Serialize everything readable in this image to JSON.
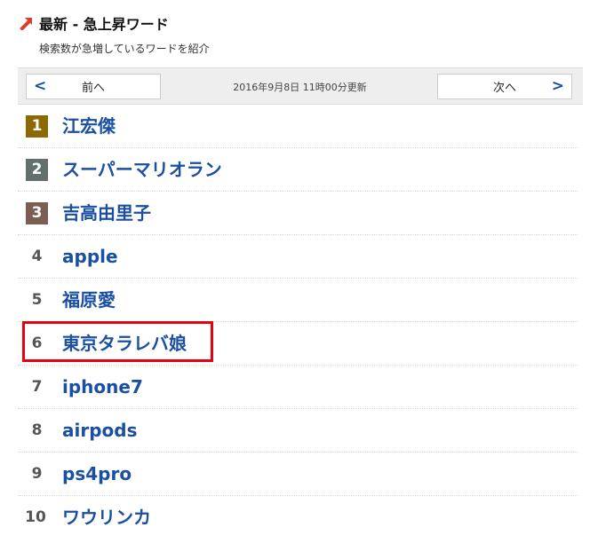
{
  "header": {
    "title": "最新 - 急上昇ワード",
    "subtitle": "検索数が急増しているワードを紹介",
    "icon": "trending-arrow-icon",
    "accent_color": "#e03a2b"
  },
  "nav": {
    "prev_label": "前へ",
    "next_label": "次へ",
    "prev_chevron": "<",
    "next_chevron": ">",
    "updated": "2016年9月8日 11時00分更新"
  },
  "ranking": [
    {
      "rank": "1",
      "word": "江宏傑"
    },
    {
      "rank": "2",
      "word": "スーパーマリオラン"
    },
    {
      "rank": "3",
      "word": "吉高由里子"
    },
    {
      "rank": "4",
      "word": "apple"
    },
    {
      "rank": "5",
      "word": "福原愛"
    },
    {
      "rank": "6",
      "word": "東京タラレバ娘"
    },
    {
      "rank": "7",
      "word": "iphone7"
    },
    {
      "rank": "8",
      "word": "airpods"
    },
    {
      "rank": "9",
      "word": "ps4pro"
    },
    {
      "rank": "10",
      "word": "ワウリンカ"
    }
  ],
  "colors": {
    "link": "#1a4fa3",
    "rank1": "#8c6a00",
    "rank2": "#62706d",
    "rank3": "#7a5e54",
    "highlight": "#e60012"
  }
}
